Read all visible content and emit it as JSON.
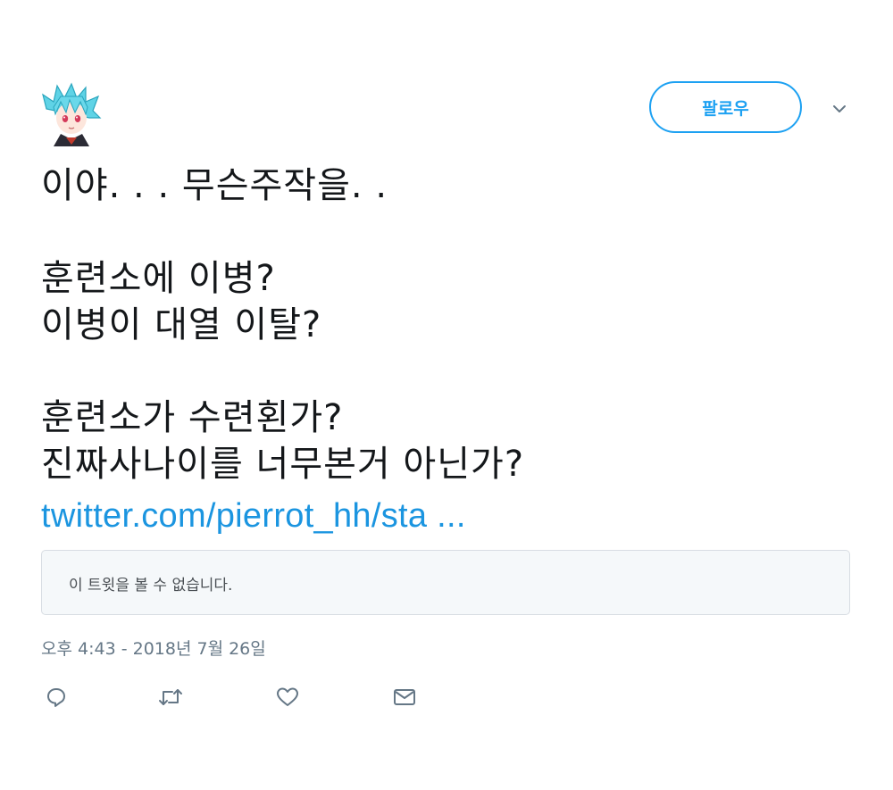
{
  "follow_button": {
    "label": "팔로우"
  },
  "tweet": {
    "lines": [
      "이야. . . 무슨주작을. .",
      "",
      "훈련소에 이병?",
      "이병이 대열 이탈?",
      "",
      "훈련소가 수련횐가?",
      "진짜사나이를 너무본거 아닌가?"
    ],
    "link_text": "twitter.com/pierrot_hh/sta ...",
    "quote_unavailable": "이 트윗을 볼 수 없습니다.",
    "timestamp": "오후 4:43 - 2018년 7월 26일"
  },
  "colors": {
    "accent": "#1da1f2",
    "link": "#1b95e0",
    "muted": "#657786",
    "text": "#14171a",
    "quote_bg": "#f5f8fa",
    "border": "#d8dde3"
  },
  "icons": {
    "avatar": "anime-avatar-blue-hair",
    "menu": "chevron-down-icon",
    "reply": "reply-bubble-icon",
    "retweet": "retweet-arrows-icon",
    "like": "heart-icon",
    "message": "envelope-icon"
  }
}
